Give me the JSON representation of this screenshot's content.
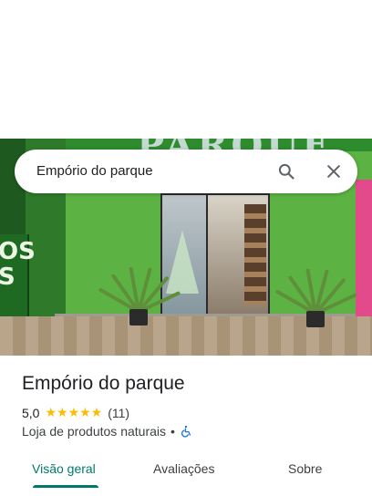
{
  "search": {
    "query": "Empório do parque"
  },
  "photo": {
    "banner_text": "PARQUE",
    "sign_text": "OS\nS"
  },
  "place": {
    "name": "Empório do parque",
    "rating": "5,0",
    "stars": "★★★★★",
    "review_count": "(11)",
    "category": "Loja de produtos naturais",
    "separator": "•",
    "accessibility_icon": "wheelchair-icon"
  },
  "tabs": [
    {
      "label": "Visão geral",
      "active": true
    },
    {
      "label": "Avaliações",
      "active": false
    },
    {
      "label": "Sobre",
      "active": false
    }
  ],
  "colors": {
    "accent": "#00796b",
    "star": "#fbbc04",
    "accessibility": "#1a73e8"
  }
}
